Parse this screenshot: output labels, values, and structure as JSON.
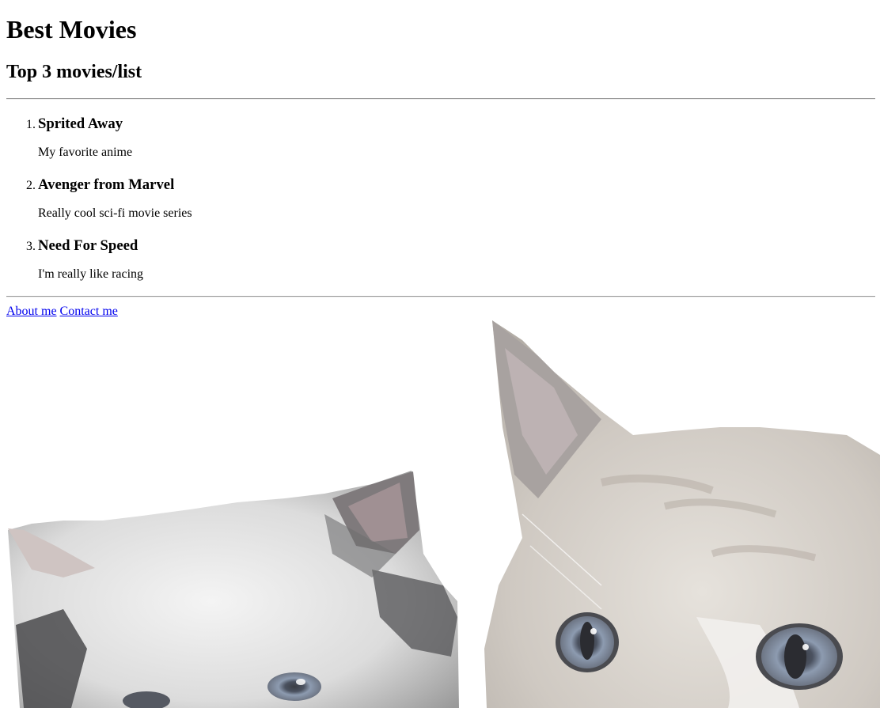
{
  "page": {
    "heading": "Best Movies",
    "subheading": "Top 3 movies/list"
  },
  "movies": [
    {
      "number": "1.",
      "title": "Sprited Away",
      "description": "My favorite anime"
    },
    {
      "number": "2.",
      "title": "Avenger from Marvel",
      "description": "Really cool sci-fi movie series"
    },
    {
      "number": "3.",
      "title": "Need For Speed",
      "description": "I'm really like racing"
    }
  ],
  "footer_links": {
    "about": "About me",
    "contact": "Contact me"
  },
  "image": {
    "subject": "two-cats-photo"
  }
}
